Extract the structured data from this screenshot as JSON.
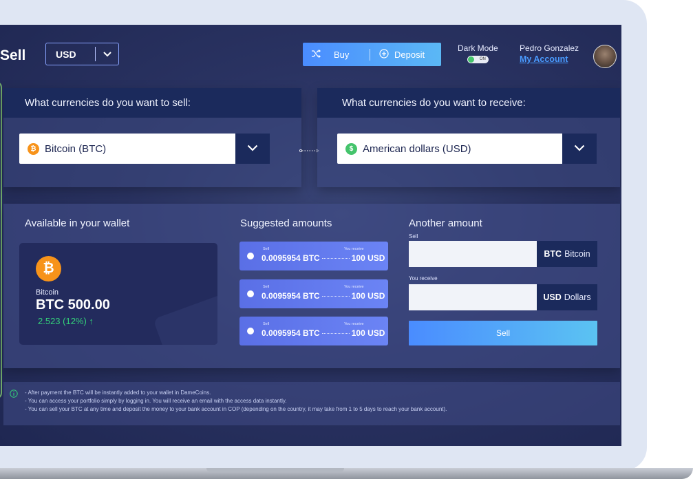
{
  "header": {
    "title": "Sell",
    "currency": "USD",
    "buy_label": "Buy",
    "deposit_label": "Deposit",
    "dark_mode_label": "Dark Mode",
    "toggle_label": "ON",
    "user_name": "Pedro Gonzalez",
    "account_link": "My Account"
  },
  "sell": {
    "question": "What currencies do you want to sell:",
    "selected": "Bitcoin (BTC)",
    "coin_symbol": "₿"
  },
  "receive": {
    "question": "What currencies do you want to receive:",
    "selected": "American dollars  (USD)",
    "coin_symbol": "$"
  },
  "wallet": {
    "title": "Available in your wallet",
    "coin_name": "Bitcoin",
    "amount": "BTC 500.00",
    "change": "2.523 (12%) ↑"
  },
  "suggested": {
    "title": "Suggested amounts",
    "items": [
      {
        "sell_label": "Sell",
        "receive_label": "You receive",
        "sell_value": "0.0095954 BTC",
        "receive_value": "100 USD"
      },
      {
        "sell_label": "Sell",
        "receive_label": "You receive",
        "sell_value": "0.0095954 BTC",
        "receive_value": "100 USD"
      },
      {
        "sell_label": "Sell",
        "receive_label": "You receive",
        "sell_value": "0.0095954 BTC",
        "receive_value": "100 USD"
      }
    ]
  },
  "another": {
    "title": "Another amount",
    "sell_label": "Sell",
    "sell_unit_code": "BTC",
    "sell_unit_name": "Bitcoin",
    "receive_label": "You receive",
    "receive_unit_code": "USD",
    "receive_unit_name": "Dollars",
    "button": "Sell"
  },
  "info": {
    "lines": [
      "- After payment the BTC will be instantly added to your wallet in DameCoins.",
      "- You can access your portfolio simply by logging in. You will receive an email with the access data instantly.",
      "- You can sell your BTC at any time and deposit the money to your bank account in COP (depending on the country, it may take from 1 to 5 days to reach your bank account)."
    ]
  },
  "colors": {
    "accent": "#4a8cff",
    "panel_head": "#1b2a5c",
    "bitcoin": "#f7931a",
    "dollar": "#45c46c",
    "positive": "#34d27a"
  }
}
